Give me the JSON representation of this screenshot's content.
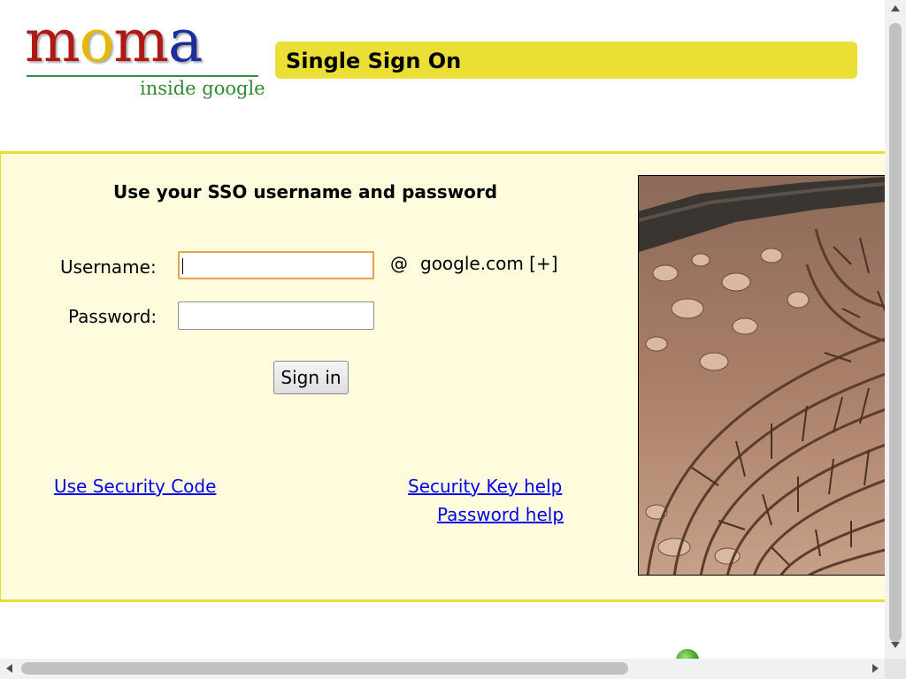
{
  "header": {
    "logo": {
      "letters": [
        {
          "char": "m",
          "color": "#b01818"
        },
        {
          "char": "o",
          "color": "#e8b800"
        },
        {
          "char": "m",
          "color": "#b01818"
        },
        {
          "char": "a",
          "color": "#1a2f9c"
        }
      ],
      "tagline": "inside google"
    },
    "title": "Single Sign On"
  },
  "login": {
    "heading": "Use your SSO username and password",
    "username_label": "Username:",
    "username_value": "",
    "password_label": "Password:",
    "password_value": "",
    "at_sign": "@",
    "domain": "google.com",
    "domain_toggle": "[+]",
    "sign_in_label": "Sign in"
  },
  "links": {
    "security_code": "Use Security Code",
    "security_key_help": "Security Key help",
    "password_help": "Password help"
  },
  "colors": {
    "title_bar": "#ebde35",
    "panel_background": "#fefcdc",
    "panel_border": "#ebdc2e",
    "link": "#0000ee",
    "focus_outline": "#e5a34b"
  }
}
